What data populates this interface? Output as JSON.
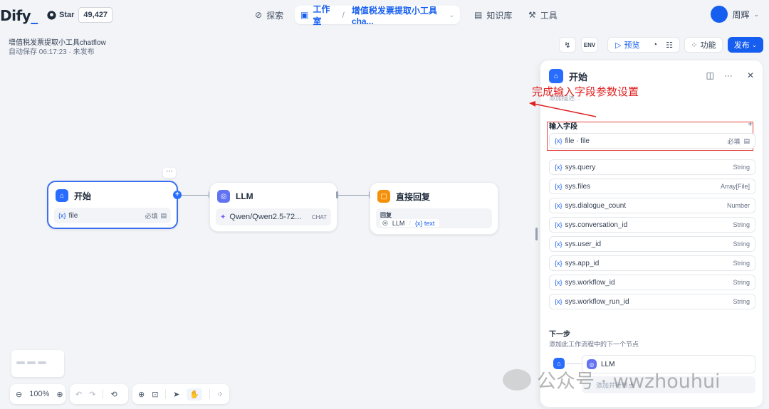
{
  "logo": {
    "text": "Dify"
  },
  "github": {
    "label": "Star",
    "count": "49,427"
  },
  "nav": {
    "explore": "探索",
    "studio": "工作室",
    "app_crumb": "增值税发票提取小工具cha...",
    "knowledge": "知识库",
    "tools": "工具"
  },
  "user": {
    "name": "周辉"
  },
  "app": {
    "title": "增值税发票提取小工具chatflow",
    "status": "自动保存 06:17:23 · 未发布"
  },
  "toolbar": {
    "preview": "预览",
    "features": "功能",
    "publish": "发布"
  },
  "nodes": {
    "start": {
      "title": "开始",
      "field_var": "{x}",
      "field": "file",
      "required": "必填"
    },
    "llm": {
      "title": "LLM",
      "model": "Qwen/Qwen2.5-72...",
      "mode": "CHAT"
    },
    "answer": {
      "title": "直接回复",
      "label": "回复",
      "ref_node": "LLM",
      "ref_var": "{x} text"
    }
  },
  "panel": {
    "title": "开始",
    "desc": "添加描述...",
    "input_section": "输入字段",
    "input_field": {
      "name": "file · file",
      "required": "必填"
    },
    "sys_vars": [
      {
        "name": "sys.query",
        "type": "String"
      },
      {
        "name": "sys.files",
        "type": "Array[File]"
      },
      {
        "name": "sys.dialogue_count",
        "type": "Number"
      },
      {
        "name": "sys.conversation_id",
        "type": "String"
      },
      {
        "name": "sys.user_id",
        "type": "String"
      },
      {
        "name": "sys.app_id",
        "type": "String"
      },
      {
        "name": "sys.workflow_id",
        "type": "String"
      },
      {
        "name": "sys.workflow_run_id",
        "type": "String"
      }
    ],
    "next_step_title": "下一步",
    "next_step_desc": "添加此工作流程中的下一个节点",
    "next_node": "LLM",
    "add_parallel": "添加并行节点"
  },
  "annotation": "完成输入字段参数设置",
  "zoom": "100%",
  "watermark": "公众号 · wwzhouhui",
  "colors": {
    "accent": "#155eef",
    "annotation": "#e02020"
  }
}
